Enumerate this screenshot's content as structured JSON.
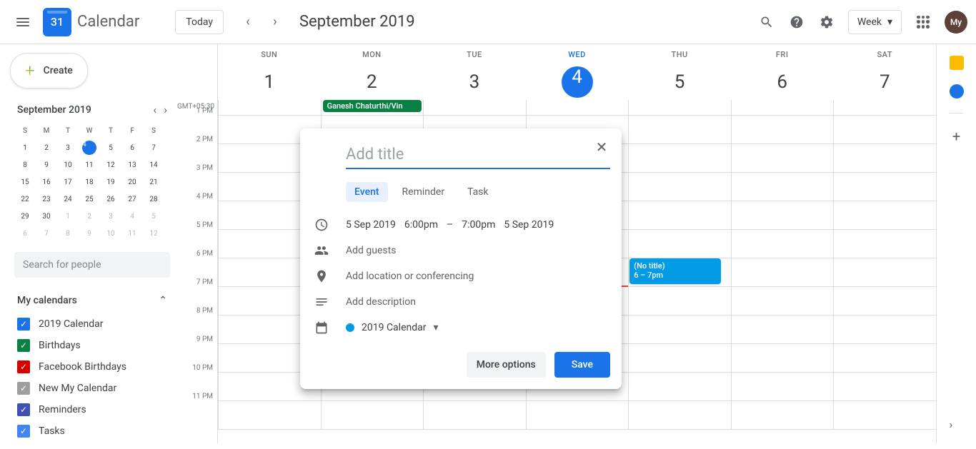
{
  "header": {
    "app_title": "Calendar",
    "logo_day": "31",
    "today_label": "Today",
    "month_title": "September 2019",
    "view_label": "Week",
    "avatar": "My"
  },
  "sidebar": {
    "create_label": "Create",
    "mini_title": "September 2019",
    "dow": [
      "S",
      "M",
      "T",
      "W",
      "T",
      "F",
      "S"
    ],
    "weeks": [
      [
        {
          "d": "1"
        },
        {
          "d": "2"
        },
        {
          "d": "3"
        },
        {
          "d": "4",
          "today": true
        },
        {
          "d": "5"
        },
        {
          "d": "6"
        },
        {
          "d": "7"
        }
      ],
      [
        {
          "d": "8"
        },
        {
          "d": "9"
        },
        {
          "d": "10"
        },
        {
          "d": "11"
        },
        {
          "d": "12"
        },
        {
          "d": "13"
        },
        {
          "d": "14"
        }
      ],
      [
        {
          "d": "15"
        },
        {
          "d": "16"
        },
        {
          "d": "17"
        },
        {
          "d": "18"
        },
        {
          "d": "19"
        },
        {
          "d": "20"
        },
        {
          "d": "21"
        }
      ],
      [
        {
          "d": "22"
        },
        {
          "d": "23"
        },
        {
          "d": "24"
        },
        {
          "d": "25"
        },
        {
          "d": "26"
        },
        {
          "d": "27"
        },
        {
          "d": "28"
        }
      ],
      [
        {
          "d": "29"
        },
        {
          "d": "30"
        },
        {
          "d": "1",
          "other": true
        },
        {
          "d": "2",
          "other": true
        },
        {
          "d": "3",
          "other": true
        },
        {
          "d": "4",
          "other": true
        },
        {
          "d": "5",
          "other": true
        }
      ],
      [
        {
          "d": "6",
          "other": true
        },
        {
          "d": "7",
          "other": true
        },
        {
          "d": "8",
          "other": true
        },
        {
          "d": "9",
          "other": true
        },
        {
          "d": "10",
          "other": true
        },
        {
          "d": "11",
          "other": true
        },
        {
          "d": "12",
          "other": true
        }
      ]
    ],
    "search_placeholder": "Search for people",
    "my_calendars_label": "My calendars",
    "calendars": [
      {
        "label": "2019 Calendar",
        "color": "#1a73e8"
      },
      {
        "label": "Birthdays",
        "color": "#0b8043"
      },
      {
        "label": "Facebook Birthdays",
        "color": "#d50000"
      },
      {
        "label": "New My Calendar",
        "color": "#9e9e9e"
      },
      {
        "label": "Reminders",
        "color": "#3f51b5"
      },
      {
        "label": "Tasks",
        "color": "#4285f4"
      }
    ]
  },
  "grid": {
    "timezone": "GMT+05:30",
    "hours": [
      "1 PM",
      "2 PM",
      "3 PM",
      "4 PM",
      "5 PM",
      "6 PM",
      "7 PM",
      "8 PM",
      "9 PM",
      "10 PM",
      "11 PM"
    ],
    "dow": [
      "SUN",
      "MON",
      "TUE",
      "WED",
      "THU",
      "FRI",
      "SAT"
    ],
    "dates": [
      "1",
      "2",
      "3",
      "4",
      "5",
      "6",
      "7"
    ],
    "today_index": 3,
    "allday_event": {
      "col": 1,
      "label": "Ganesh Chaturthi/Vin"
    },
    "event": {
      "title": "(No title)",
      "time": "6 – 7pm"
    }
  },
  "modal": {
    "title_placeholder": "Add title",
    "tabs": [
      "Event",
      "Reminder",
      "Task"
    ],
    "date_start": "5 Sep 2019",
    "time_start": "6:00pm",
    "dash": "–",
    "time_end": "7:00pm",
    "date_end": "5 Sep 2019",
    "guests": "Add guests",
    "location": "Add location or conferencing",
    "description": "Add description",
    "calendar": "2019 Calendar",
    "more_label": "More options",
    "save_label": "Save"
  }
}
